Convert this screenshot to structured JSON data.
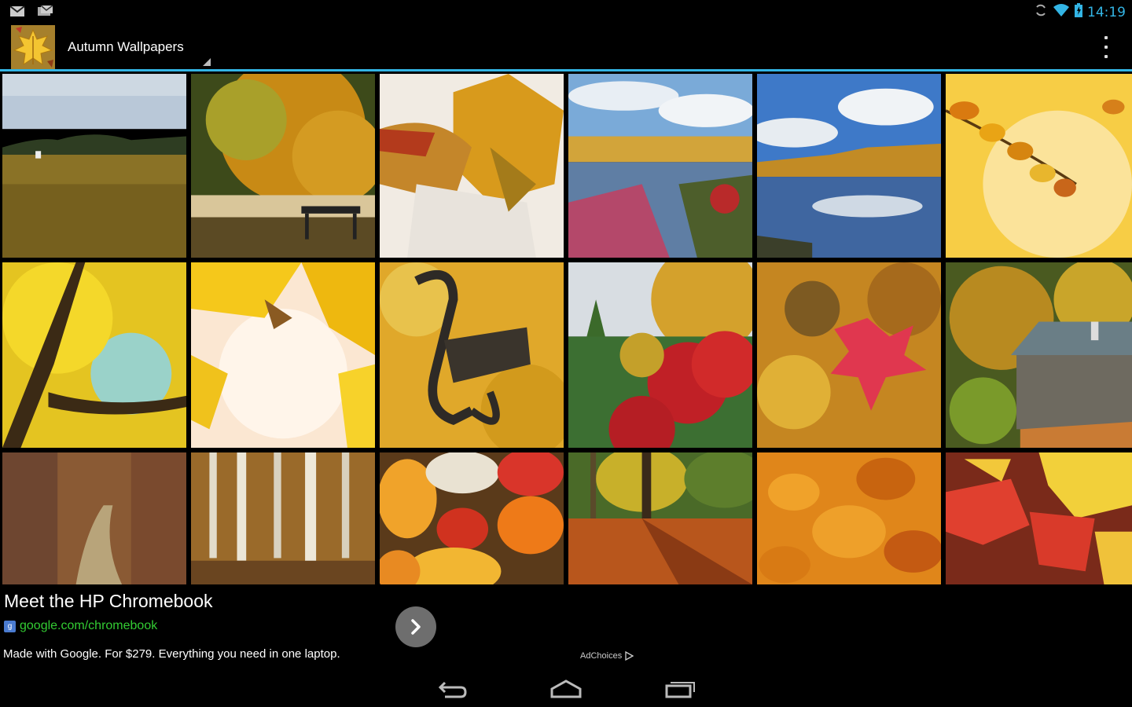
{
  "status_bar": {
    "time": "14:19",
    "icons": [
      "gmail-icon",
      "mail-icon",
      "sync-icon",
      "wifi-icon",
      "battery-icon"
    ],
    "accent": "#33b5e5"
  },
  "action_bar": {
    "title": "Autumn Wallpapers",
    "icon": "autumn-leaf-app-icon",
    "menu_icon": "overflow-menu-icon",
    "underline_color": "#33b5e5"
  },
  "gallery": {
    "columns": 6,
    "tiles": [
      {
        "label": "wallpaper-field"
      },
      {
        "label": "wallpaper-park-bench"
      },
      {
        "label": "wallpaper-leaf-basket"
      },
      {
        "label": "wallpaper-lake-birches"
      },
      {
        "label": "wallpaper-lake-sky"
      },
      {
        "label": "wallpaper-yellow-branch"
      },
      {
        "label": "wallpaper-yellow-tree"
      },
      {
        "label": "wallpaper-bright-leaves"
      },
      {
        "label": "wallpaper-iron-bench"
      },
      {
        "label": "wallpaper-red-shrubs"
      },
      {
        "label": "wallpaper-red-leaf"
      },
      {
        "label": "wallpaper-old-shed"
      },
      {
        "label": "wallpaper-forest-path"
      },
      {
        "label": "wallpaper-birch-forest"
      },
      {
        "label": "wallpaper-pumpkins"
      },
      {
        "label": "wallpaper-park-trees"
      },
      {
        "label": "wallpaper-leaf-carpet"
      },
      {
        "label": "wallpaper-maple-leaves"
      }
    ]
  },
  "ad": {
    "headline": "Meet the HP Chromebook",
    "url": "google.com/chromebook",
    "description": "Made with Google. For $279. Everything you need in one laptop.",
    "adchoices_label": "AdChoices",
    "url_color": "#33cc33"
  },
  "nav_bar": {
    "buttons": [
      "back-icon",
      "home-icon",
      "recent-apps-icon"
    ]
  }
}
